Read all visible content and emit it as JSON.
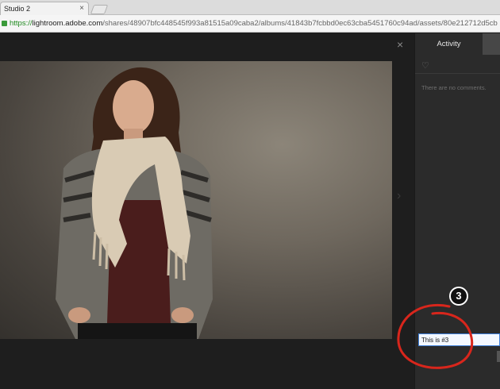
{
  "browser": {
    "tab_title": "Studio 2",
    "tab_close": "×",
    "url_scheme": "https://",
    "url_host": "lightroom.adobe.com",
    "url_path": "/shares/48907bfc448545f993a81515a09caba2/albums/41843b7fcbbd0ec63cba5451760c94ad/assets/80e212712d5cbdcbc6d813db..."
  },
  "viewer": {
    "close_glyph": "×",
    "next_glyph": "›"
  },
  "sidebar": {
    "activity_tab": "Activity",
    "heart_glyph": "♡",
    "no_comments": "There are no comments."
  },
  "comment": {
    "value": "This is #3"
  },
  "annotation": {
    "badge": "3",
    "circle_color": "#d8261c"
  },
  "colors": {
    "secure": "#1f8a1f",
    "input_focus": "#3d7ed8"
  }
}
